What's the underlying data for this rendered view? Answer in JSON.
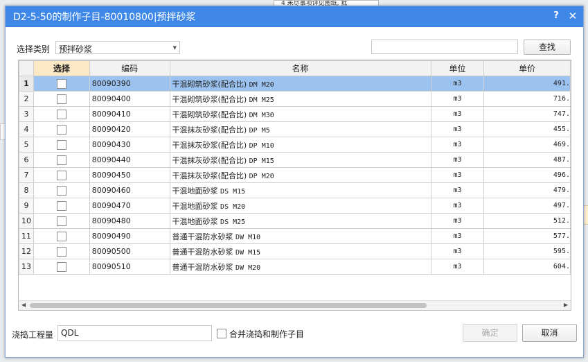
{
  "background": {
    "top_fragment": "4 未尽事项详见图纸, 批"
  },
  "dialog": {
    "title": "D2-5-50的制作子目-80010800|预拌砂浆",
    "help_label": "?",
    "close_label": "✕"
  },
  "filter": {
    "category_label": "选择类别",
    "category_value": "预拌砂浆",
    "search_value": "",
    "find_label": "查找"
  },
  "table": {
    "headers": {
      "select": "选择",
      "code": "编码",
      "name": "名称",
      "unit": "单位",
      "price": "单价"
    },
    "rows": [
      {
        "no": "1",
        "code": "80090390",
        "name_cn": "干混砌筑砂浆(配合比)",
        "name_lat": "DM M20",
        "unit": "m3",
        "price": "491."
      },
      {
        "no": "2",
        "code": "80090400",
        "name_cn": "干混砌筑砂浆(配合比)",
        "name_lat": "DM M25",
        "unit": "m3",
        "price": "716."
      },
      {
        "no": "3",
        "code": "80090410",
        "name_cn": "干混砌筑砂浆(配合比)",
        "name_lat": "DM M30",
        "unit": "m3",
        "price": "747."
      },
      {
        "no": "4",
        "code": "80090420",
        "name_cn": "干混抹灰砂浆(配合比)",
        "name_lat": "DP M5",
        "unit": "m3",
        "price": "455."
      },
      {
        "no": "5",
        "code": "80090430",
        "name_cn": "干混抹灰砂浆(配合比)",
        "name_lat": "DP M10",
        "unit": "m3",
        "price": "469."
      },
      {
        "no": "6",
        "code": "80090440",
        "name_cn": "干混抹灰砂浆(配合比)",
        "name_lat": "DP M15",
        "unit": "m3",
        "price": "487."
      },
      {
        "no": "7",
        "code": "80090450",
        "name_cn": "干混抹灰砂浆(配合比)",
        "name_lat": "DP M20",
        "unit": "m3",
        "price": "496."
      },
      {
        "no": "8",
        "code": "80090460",
        "name_cn": "干混地面砂浆",
        "name_lat": "DS M15",
        "unit": "m3",
        "price": "479."
      },
      {
        "no": "9",
        "code": "80090470",
        "name_cn": "干混地面砂浆",
        "name_lat": "DS M20",
        "unit": "m3",
        "price": "497."
      },
      {
        "no": "10",
        "code": "80090480",
        "name_cn": "干混地面砂浆",
        "name_lat": "DS M25",
        "unit": "m3",
        "price": "512."
      },
      {
        "no": "11",
        "code": "80090490",
        "name_cn": "普通干混防水砂浆",
        "name_lat": "DW M10",
        "unit": "m3",
        "price": "577."
      },
      {
        "no": "12",
        "code": "80090500",
        "name_cn": "普通干混防水砂浆",
        "name_lat": "DW M15",
        "unit": "m3",
        "price": "595."
      },
      {
        "no": "13",
        "code": "80090510",
        "name_cn": "普通干混防水砂浆",
        "name_lat": "DW M20",
        "unit": "m3",
        "price": "604."
      }
    ]
  },
  "footer": {
    "quantity_label": "浇捣工程量",
    "quantity_value": "QDL",
    "merge_label": "合并浇捣和制作子目",
    "ok_label": "确定",
    "cancel_label": "取消"
  },
  "colors": {
    "titlebar": "#3f88e8",
    "selected_row": "#9cc2ef",
    "select_header": "#fde8c6"
  }
}
